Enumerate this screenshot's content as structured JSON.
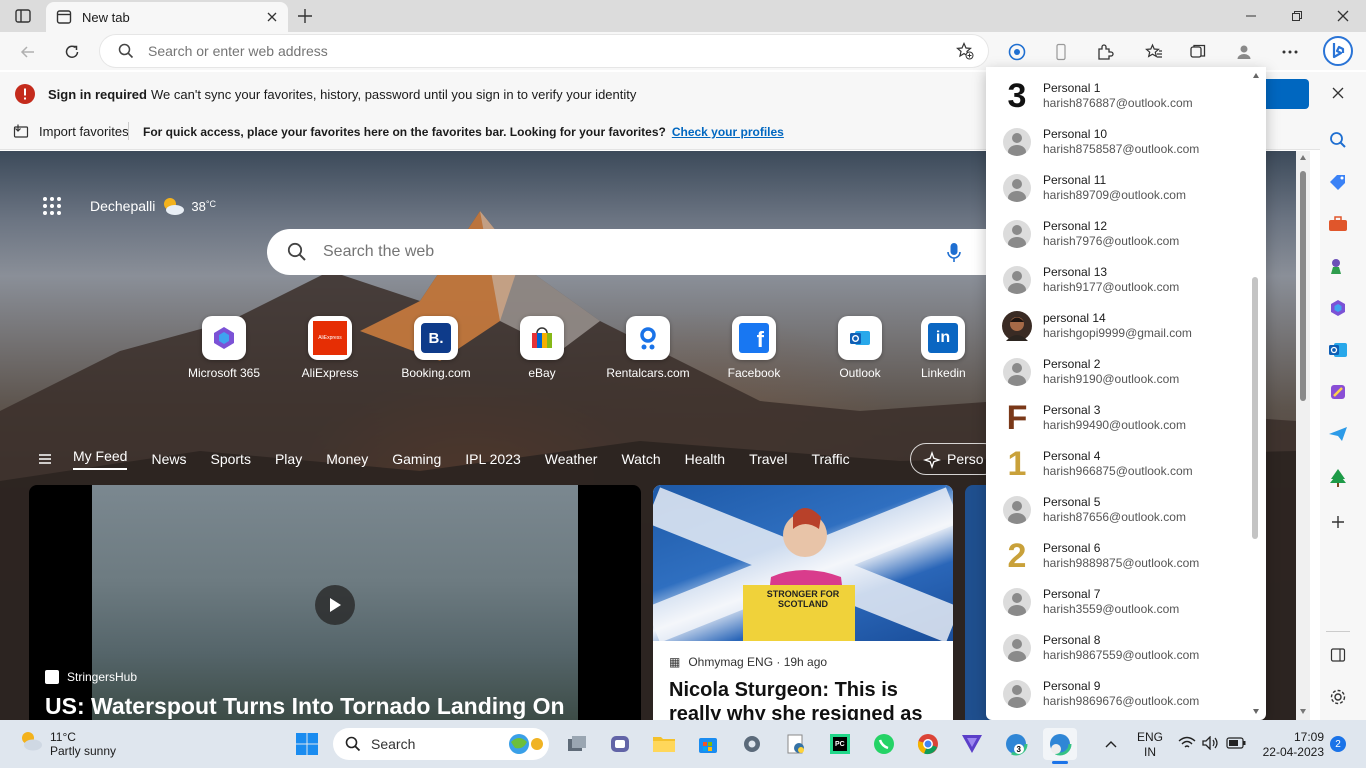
{
  "browser": {
    "tab_title": "New tab",
    "address_placeholder": "Search or enter web address"
  },
  "signin_bar": {
    "title": "Sign in required",
    "message": "We can't sync your favorites, history, password until you sign in to verify your identity"
  },
  "favorites_bar": {
    "import_label": "Import favorites",
    "message": "For quick access, place your favorites here on the favorites bar. Looking for your favorites?",
    "link": "Check your profiles"
  },
  "newtab": {
    "location": "Dechepalli",
    "temperature": "38",
    "temp_unit": "°C",
    "search_placeholder": "Search the web",
    "quick_links": [
      {
        "label": "Microsoft 365",
        "icon": "microsoft365-icon"
      },
      {
        "label": "AliExpress",
        "icon": "aliexpress-icon"
      },
      {
        "label": "Booking.com",
        "icon": "booking-icon"
      },
      {
        "label": "eBay",
        "icon": "ebay-icon"
      },
      {
        "label": "Rentalcars.com",
        "icon": "rentalcars-icon"
      },
      {
        "label": "Facebook",
        "icon": "facebook-icon"
      },
      {
        "label": "Outlook",
        "icon": "outlook-icon"
      },
      {
        "label": "Linkedin",
        "icon": "linkedin-icon"
      }
    ],
    "feed_tabs": [
      "My Feed",
      "News",
      "Sports",
      "Play",
      "Money",
      "Gaming",
      "IPL 2023",
      "Weather",
      "Watch",
      "Health",
      "Travel",
      "Traffic"
    ],
    "personalize_label": "Perso",
    "cards": [
      {
        "source": "StringersHub",
        "headline": "US: Waterspout Turns Into Tornado Landing On"
      },
      {
        "source": "Ohmymag ENG · 19h ago",
        "headline": "Nicola Sturgeon: This is really why she resigned as",
        "image_text": "STRONGER FOR SCOTLAND"
      }
    ]
  },
  "profiles": [
    {
      "name": "Personal 1",
      "email": "harish876887@outlook.com",
      "avatar": "3"
    },
    {
      "name": "Personal 10",
      "email": "harish8758587@outlook.com",
      "avatar": "default"
    },
    {
      "name": "Personal 11",
      "email": "harish89709@outlook.com",
      "avatar": "default"
    },
    {
      "name": "Personal 12",
      "email": "harish7976@outlook.com",
      "avatar": "default"
    },
    {
      "name": "Personal 13",
      "email": "harish9177@outlook.com",
      "avatar": "default"
    },
    {
      "name": "personal 14",
      "email": "harishgopi9999@gmail.com",
      "avatar": "photo"
    },
    {
      "name": "Personal 2",
      "email": "harish9190@outlook.com",
      "avatar": "default"
    },
    {
      "name": "Personal 3",
      "email": "harish99490@outlook.com",
      "avatar": "F"
    },
    {
      "name": "Personal 4",
      "email": "harish966875@outlook.com",
      "avatar": "1"
    },
    {
      "name": "Personal 5",
      "email": "harish87656@outlook.com",
      "avatar": "default"
    },
    {
      "name": "Personal 6",
      "email": "harish9889875@outlook.com",
      "avatar": "2"
    },
    {
      "name": "Personal 7",
      "email": "harish3559@outlook.com",
      "avatar": "default"
    },
    {
      "name": "Personal 8",
      "email": "harish9867559@outlook.com",
      "avatar": "default"
    },
    {
      "name": "Personal 9",
      "email": "harish9869676@outlook.com",
      "avatar": "default"
    }
  ],
  "taskbar": {
    "weather_temp": "11°C",
    "weather_desc": "Partly sunny",
    "search_label": "Search",
    "lang": "ENG",
    "region": "IN",
    "time": "17:09",
    "date": "22-04-2023",
    "notification_count": "2"
  },
  "colors": {
    "accent": "#0067c0",
    "error": "#c42b1c",
    "taskbar": "#dfe6ee"
  }
}
